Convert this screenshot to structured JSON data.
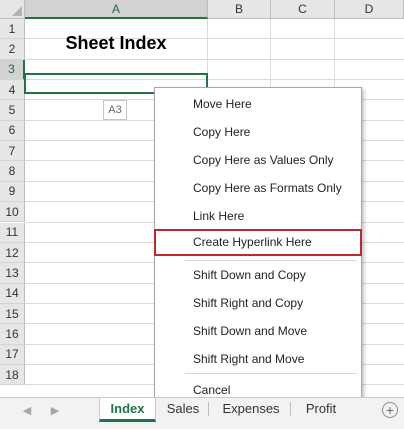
{
  "columns": [
    "A",
    "B",
    "C",
    "D"
  ],
  "rows": [
    "1",
    "2",
    "3",
    "4",
    "5",
    "6",
    "7",
    "8",
    "9",
    "10",
    "11",
    "12",
    "13",
    "14",
    "15",
    "16",
    "17",
    "18"
  ],
  "cells": {
    "A1": "Sheet Index"
  },
  "drag_tooltip": "A3",
  "context_menu": {
    "items": [
      {
        "label": "Move Here"
      },
      {
        "label": "Copy Here"
      },
      {
        "label": "Copy Here as Values Only"
      },
      {
        "label": "Copy Here as Formats Only"
      },
      {
        "label": "Link Here"
      },
      {
        "label": "Create Hyperlink Here",
        "highlighted": true
      },
      {
        "label": "Shift Down and Copy"
      },
      {
        "label": "Shift Right and Copy"
      },
      {
        "label": "Shift Down and Move"
      },
      {
        "label": "Shift Right and Move"
      },
      {
        "label": "Cancel"
      }
    ]
  },
  "sheet_tabs": [
    {
      "label": "Index",
      "active": true
    },
    {
      "label": "Sales"
    },
    {
      "label": "Expenses"
    },
    {
      "label": "Profit"
    }
  ],
  "nav_icons": [
    "scroll-left-icon",
    "scroll-right-icon"
  ],
  "add_sheet_icon": "plus-circle-icon",
  "colors": {
    "accent": "#217346",
    "highlight_border": "#c0282d"
  }
}
